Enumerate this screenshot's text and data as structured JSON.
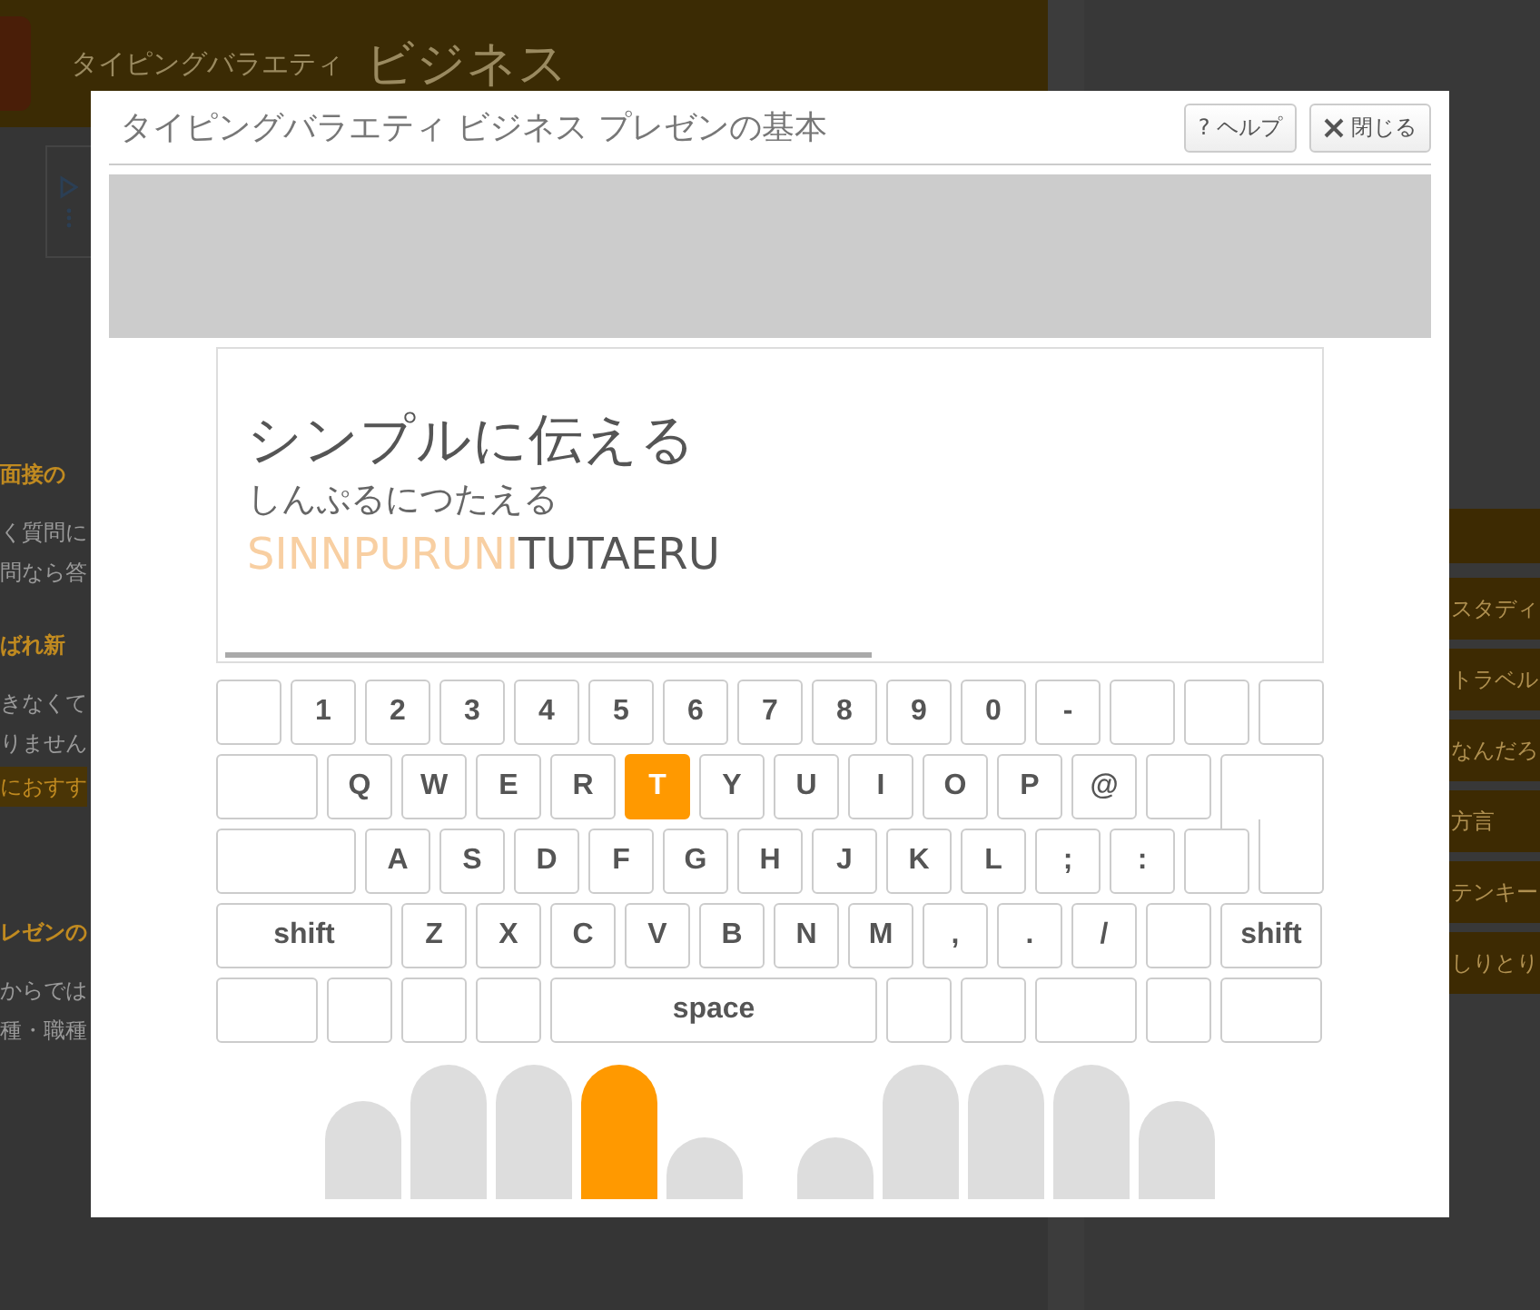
{
  "background_page": {
    "header": {
      "site_name": "タイピングバラエティ",
      "section": "ビジネス"
    },
    "left_texts": [
      {
        "kind": "heading",
        "text": "面接の"
      },
      {
        "kind": "body",
        "text": "く質問に"
      },
      {
        "kind": "body",
        "text": "問なら答"
      },
      {
        "kind": "heading",
        "text": "ばれ新"
      },
      {
        "kind": "body",
        "text": "きなくて"
      },
      {
        "kind": "body",
        "text": "りません"
      },
      {
        "kind": "band",
        "text": "におすす"
      },
      {
        "kind": "heading",
        "text": "レゼンの"
      },
      {
        "kind": "body",
        "text": "からでは"
      },
      {
        "kind": "body",
        "text": "種・職種"
      }
    ],
    "menu_items": [
      "スタディ",
      "トラベル",
      "なんだろ",
      "方言",
      "テンキー",
      "しりとり"
    ]
  },
  "dialog": {
    "title": "タイピングバラエティ ビジネス プレゼンの基本",
    "buttons": [
      {
        "kind": "help",
        "label": "? ヘルプ"
      },
      {
        "kind": "close",
        "label": "閉じる"
      }
    ],
    "word": {
      "text": "シンプルに伝える",
      "kana": "しんぷるにつたえる",
      "typed": "SINNPURUNI",
      "remaining": "TUTAERU",
      "progress": {
        "level": 0.6
      }
    },
    "keyboard": [
      [
        {
          "kind": "char",
          "selected": false
        },
        {
          "kind": "char",
          "label": "1",
          "selected": false
        },
        {
          "kind": "char",
          "label": "2",
          "selected": false
        },
        {
          "kind": "char",
          "label": "3",
          "selected": false
        },
        {
          "kind": "char",
          "label": "4",
          "selected": false
        },
        {
          "kind": "char",
          "label": "5",
          "selected": false
        },
        {
          "kind": "char",
          "label": "6",
          "selected": false
        },
        {
          "kind": "char",
          "label": "7",
          "selected": false
        },
        {
          "kind": "char",
          "label": "8",
          "selected": false
        },
        {
          "kind": "char",
          "label": "9",
          "selected": false
        },
        {
          "kind": "char",
          "label": "0",
          "selected": false
        },
        {
          "kind": "char",
          "label": "-",
          "selected": false
        },
        {
          "kind": "char",
          "selected": false
        },
        {
          "kind": "char",
          "selected": false
        },
        {
          "kind": "char",
          "selected": false
        }
      ],
      [
        {
          "kind": "wide",
          "selected": false
        },
        {
          "kind": "char",
          "label": "Q",
          "selected": false
        },
        {
          "kind": "char",
          "label": "W",
          "selected": false
        },
        {
          "kind": "char",
          "label": "E",
          "selected": false
        },
        {
          "kind": "char",
          "label": "R",
          "selected": false
        },
        {
          "kind": "char",
          "label": "T",
          "selected": true
        },
        {
          "kind": "char",
          "label": "Y",
          "selected": false
        },
        {
          "kind": "char",
          "label": "U",
          "selected": false
        },
        {
          "kind": "char",
          "label": "I",
          "selected": false
        },
        {
          "kind": "char",
          "label": "O",
          "selected": false
        },
        {
          "kind": "char",
          "label": "P",
          "selected": false
        },
        {
          "kind": "char",
          "label": "@",
          "selected": false
        },
        {
          "kind": "char",
          "selected": false
        },
        {
          "kind": "enter",
          "selected": false
        }
      ],
      [
        {
          "kind": "caps",
          "selected": false
        },
        {
          "kind": "char",
          "label": "A",
          "selected": false
        },
        {
          "kind": "char",
          "label": "S",
          "selected": false
        },
        {
          "kind": "char",
          "label": "D",
          "selected": false
        },
        {
          "kind": "char",
          "label": "F",
          "selected": false
        },
        {
          "kind": "char",
          "label": "G",
          "selected": false
        },
        {
          "kind": "char",
          "label": "H",
          "selected": false
        },
        {
          "kind": "char",
          "label": "J",
          "selected": false
        },
        {
          "kind": "char",
          "label": "K",
          "selected": false
        },
        {
          "kind": "char",
          "label": "L",
          "selected": false
        },
        {
          "kind": "char",
          "label": ";",
          "selected": false
        },
        {
          "kind": "char",
          "label": ":",
          "selected": false
        },
        {
          "kind": "char",
          "selected": false
        },
        {
          "kind": "enter-tail",
          "selected": false
        }
      ],
      [
        {
          "kind": "shift",
          "label": "shift",
          "selected": false
        },
        {
          "kind": "char",
          "label": "Z",
          "selected": false
        },
        {
          "kind": "char",
          "label": "X",
          "selected": false
        },
        {
          "kind": "char",
          "label": "C",
          "selected": false
        },
        {
          "kind": "char",
          "label": "V",
          "selected": false
        },
        {
          "kind": "char",
          "label": "B",
          "selected": false
        },
        {
          "kind": "char",
          "label": "N",
          "selected": false
        },
        {
          "kind": "char",
          "label": "M",
          "selected": false
        },
        {
          "kind": "char",
          "label": ",",
          "selected": false
        },
        {
          "kind": "char",
          "label": ".",
          "selected": false
        },
        {
          "kind": "char",
          "label": "/",
          "selected": false
        },
        {
          "kind": "char",
          "selected": false
        },
        {
          "kind": "wide",
          "label": "shift",
          "selected": false
        }
      ],
      [
        {
          "kind": "wide",
          "selected": false
        },
        {
          "kind": "char",
          "selected": false
        },
        {
          "kind": "char",
          "selected": false
        },
        {
          "kind": "char",
          "selected": false
        },
        {
          "kind": "space",
          "label": "space",
          "selected": false
        },
        {
          "kind": "char",
          "selected": false
        },
        {
          "kind": "char",
          "selected": false
        },
        {
          "kind": "wide",
          "selected": false
        },
        {
          "kind": "char",
          "selected": false
        },
        {
          "kind": "wide",
          "selected": false
        }
      ]
    ],
    "hands": [
      [
        {
          "kind": "pinky",
          "selected": false
        },
        {
          "kind": "finger",
          "selected": false
        },
        {
          "kind": "finger",
          "selected": false
        },
        {
          "kind": "finger",
          "selected": true
        },
        {
          "kind": "thumb",
          "selected": false
        }
      ],
      [
        {
          "kind": "thumb",
          "selected": false
        },
        {
          "kind": "finger",
          "selected": false
        },
        {
          "kind": "finger",
          "selected": false
        },
        {
          "kind": "finger",
          "selected": false
        },
        {
          "kind": "pinky",
          "selected": false
        }
      ]
    ]
  }
}
